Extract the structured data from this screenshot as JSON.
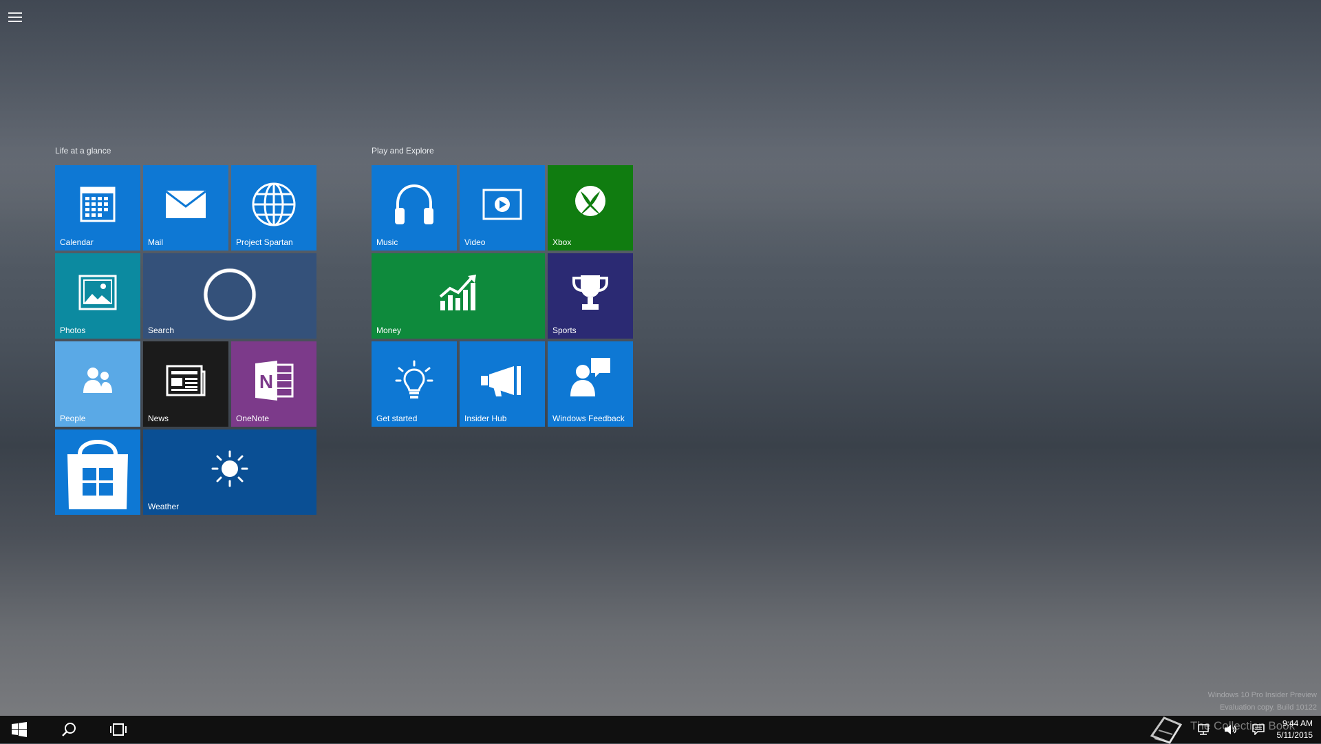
{
  "groups": [
    {
      "title": "Life at a glance"
    },
    {
      "title": "Play and Explore"
    }
  ],
  "tiles": {
    "calendar": {
      "label": "Calendar",
      "color": "#0e78d4"
    },
    "mail": {
      "label": "Mail",
      "color": "#0e78d4"
    },
    "spartan": {
      "label": "Project Spartan",
      "color": "#0e78d4"
    },
    "photos": {
      "label": "Photos",
      "color": "#0c8aa0"
    },
    "search": {
      "label": "Search",
      "color": "#34517a"
    },
    "people": {
      "label": "People",
      "color": "#5aa9e6"
    },
    "news": {
      "label": "News",
      "color": "#1b1b1b"
    },
    "onenote": {
      "label": "OneNote",
      "color": "#7c3a8a"
    },
    "store": {
      "label": "",
      "color": "#0e78d4"
    },
    "weather": {
      "label": "Weather",
      "color": "#0a4f94"
    },
    "music": {
      "label": "Music",
      "color": "#0e78d4"
    },
    "video": {
      "label": "Video",
      "color": "#0e78d4"
    },
    "xbox": {
      "label": "Xbox",
      "color": "#107c10"
    },
    "money": {
      "label": "Money",
      "color": "#0e8a3c"
    },
    "sports": {
      "label": "Sports",
      "color": "#2b2a73"
    },
    "getstarted": {
      "label": "Get started",
      "color": "#0e78d4"
    },
    "insiderhub": {
      "label": "Insider Hub",
      "color": "#0e78d4"
    },
    "feedback": {
      "label": "Windows Feedback",
      "color": "#0e78d4"
    }
  },
  "taskbar": {
    "time": "9:44 AM",
    "date": "5/11/2015"
  },
  "watermark": {
    "line1": "Windows 10 Pro Insider Preview",
    "line2": "Evaluation copy. Build 10122",
    "brand": "The Collection Book"
  },
  "icons": [
    "menu-icon",
    "calendar-icon",
    "mail-icon",
    "globe-icon",
    "photos-icon",
    "cortana-ring-icon",
    "people-icon",
    "news-icon",
    "onenote-icon",
    "store-icon",
    "weather-sun-icon",
    "headphones-icon",
    "video-icon",
    "xbox-icon",
    "money-chart-icon",
    "trophy-icon",
    "lightbulb-icon",
    "megaphone-icon",
    "feedback-icon",
    "windows-start-icon",
    "search-icon",
    "task-view-icon",
    "network-icon",
    "volume-icon",
    "notification-icon",
    "book-icon"
  ]
}
